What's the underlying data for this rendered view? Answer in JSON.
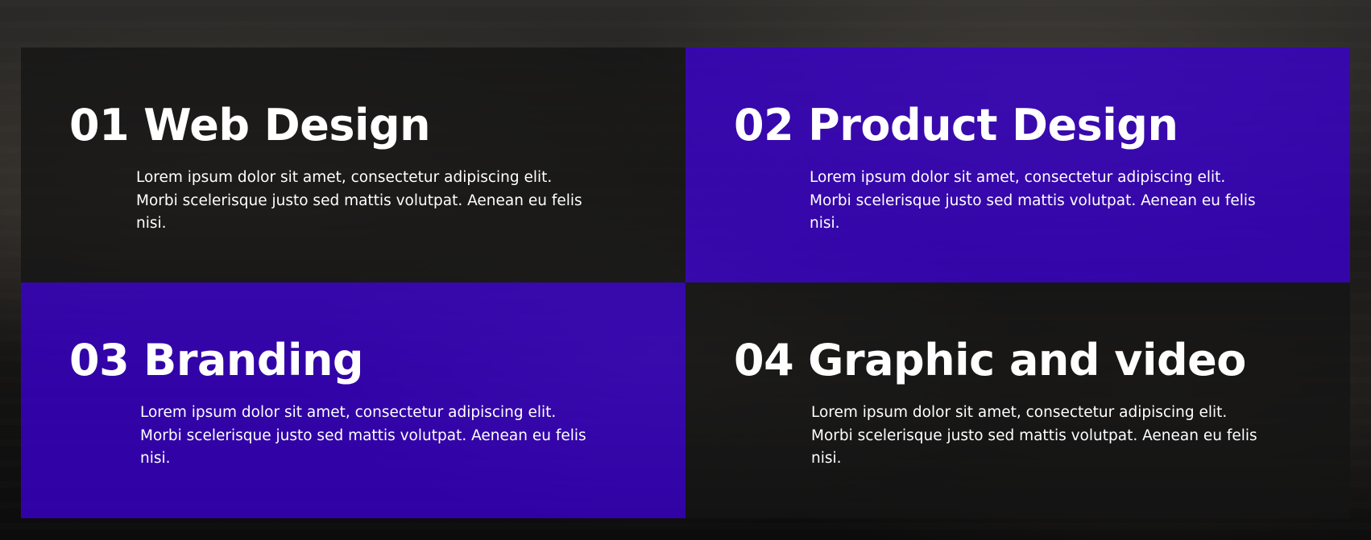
{
  "services": [
    {
      "number": "01",
      "title": "Web Design",
      "description": "Lorem ipsum dolor sit amet, consectetur adipiscing elit. Morbi scelerisque justo sed mattis volutpat. Aenean eu felis nisi."
    },
    {
      "number": "02",
      "title": "Product Design",
      "description": "Lorem ipsum dolor sit amet, consectetur adipiscing elit. Morbi scelerisque justo sed mattis volutpat. Aenean eu felis nisi."
    },
    {
      "number": "03",
      "title": "Branding",
      "description": "Lorem ipsum dolor sit amet, consectetur adipiscing elit. Morbi scelerisque justo sed mattis volutpat. Aenean eu felis nisi."
    },
    {
      "number": "04",
      "title": "Graphic and video",
      "description": "Lorem ipsum dolor sit amet, consectetur adipiscing elit. Morbi scelerisque justo sed mattis volutpat. Aenean eu felis nisi."
    }
  ],
  "colors": {
    "accent_purple": "#3A00CC",
    "dark_panel": "#141414",
    "text": "#FFFFFF"
  }
}
